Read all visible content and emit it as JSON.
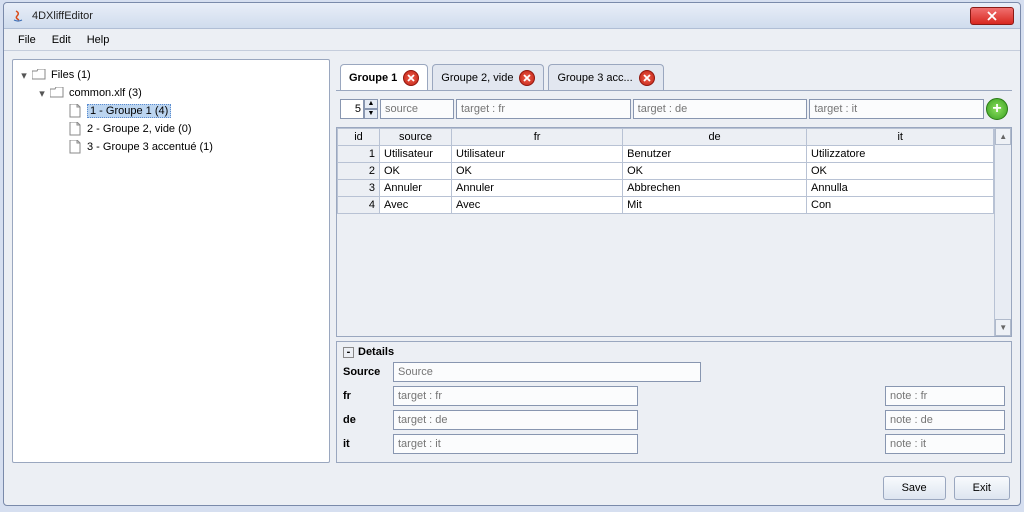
{
  "window": {
    "title": "4DXliffEditor"
  },
  "menu": {
    "file": "File",
    "edit": "Edit",
    "help": "Help"
  },
  "tree": {
    "root": "Files (1)",
    "file": "common.xlf (3)",
    "items": [
      "1 - Groupe 1 (4)",
      "2 - Groupe 2, vide (0)",
      "3 - Groupe 3 accentué (1)"
    ]
  },
  "tabs": [
    {
      "label": "Groupe 1"
    },
    {
      "label": "Groupe 2, vide"
    },
    {
      "label": "Groupe 3 acc..."
    }
  ],
  "inputRow": {
    "spin": "5",
    "ph_source": "source",
    "ph_fr": "target : fr",
    "ph_de": "target : de",
    "ph_it": "target : it"
  },
  "table": {
    "headers": {
      "id": "id",
      "source": "source",
      "fr": "fr",
      "de": "de",
      "it": "it"
    },
    "rows": [
      {
        "id": "1",
        "source": "Utilisateur",
        "fr": "Utilisateur",
        "de": "Benutzer",
        "it": "Utilizzatore"
      },
      {
        "id": "2",
        "source": "OK",
        "fr": "OK",
        "de": "OK",
        "it": "OK"
      },
      {
        "id": "3",
        "source": "Annuler",
        "fr": "Annuler",
        "de": "Abbrechen",
        "it": "Annulla"
      },
      {
        "id": "4",
        "source": "Avec",
        "fr": "Avec",
        "de": "Mit",
        "it": "Con"
      }
    ]
  },
  "details": {
    "title": "Details",
    "rows": [
      {
        "label": "Source",
        "ph": "Source",
        "note": ""
      },
      {
        "label": "fr",
        "ph": "target : fr",
        "note": "note : fr"
      },
      {
        "label": "de",
        "ph": "target : de",
        "note": "note : de"
      },
      {
        "label": "it",
        "ph": "target : it",
        "note": "note : it"
      }
    ]
  },
  "footer": {
    "save": "Save",
    "exit": "Exit"
  }
}
